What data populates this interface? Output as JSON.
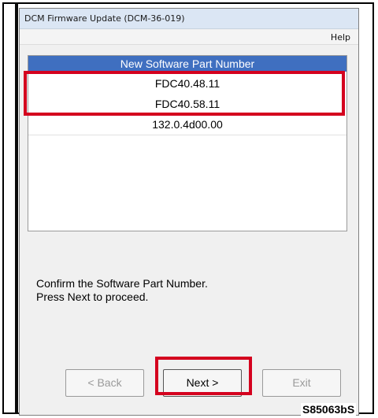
{
  "window": {
    "title": "DCM Firmware Update (DCM-36-019)",
    "menu": {
      "help": "Help"
    }
  },
  "list": {
    "header": "New Software Part Number",
    "rows": [
      "FDC40.48.11",
      "FDC40.58.11",
      "132.0.4d00.00"
    ]
  },
  "instruction": {
    "line1": "Confirm the Software Part Number.",
    "line2": "Press Next to proceed."
  },
  "buttons": {
    "back": "< Back",
    "next": "Next >",
    "exit": "Exit"
  },
  "figure_id": "S85063bS",
  "colors": {
    "highlight": "#d4001e",
    "list_header_bg": "#3f6fc0"
  }
}
